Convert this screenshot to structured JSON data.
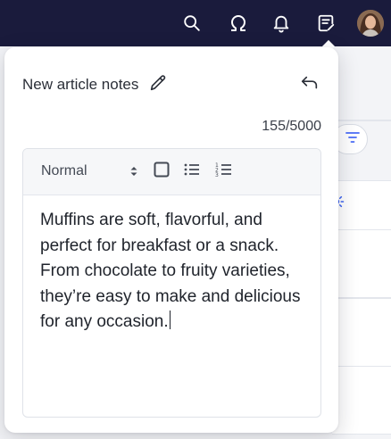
{
  "topbar": {
    "icons": [
      "search-icon",
      "omega-icon",
      "bell-icon",
      "notes-icon",
      "avatar"
    ]
  },
  "panel": {
    "title": "New article notes",
    "char_count": "155/5000",
    "editor": {
      "format_value": "Normal",
      "content": "Muffins are soft, flavorful, and perfect for breakfast or a snack. From chocolate to fruity varieties, they’re easy to make and delicious for any occasion."
    }
  },
  "colors": {
    "topbar": "#1a1b3c",
    "panel_bg": "#ffffff",
    "toolbar_bg": "#f6f7f9",
    "accent": "#3b63f2"
  }
}
